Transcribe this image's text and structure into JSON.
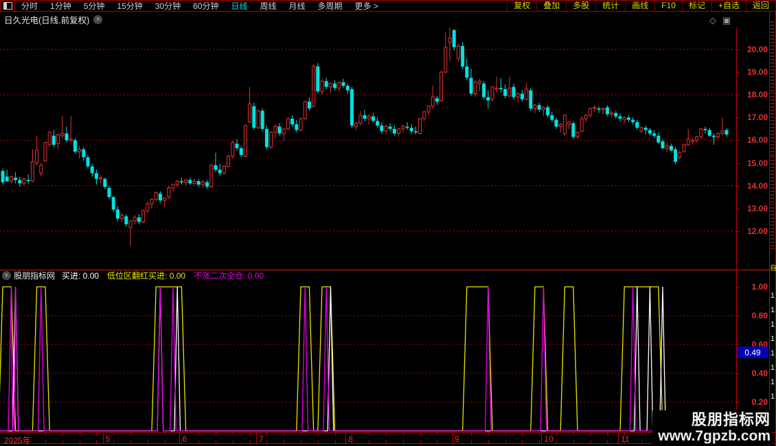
{
  "toolbar": {
    "periods": [
      "分时",
      "1分钟",
      "5分钟",
      "15分钟",
      "30分钟",
      "60分钟",
      "日线",
      "周线",
      "月线",
      "多周期"
    ],
    "active_period": "日线",
    "more_label": "更多 >",
    "right_buttons": [
      "复权",
      "叠加",
      "多股",
      "统计",
      "画线",
      "F10",
      "标记",
      "+自选",
      "返回"
    ]
  },
  "title": {
    "text": "日久光电(日线.前复权)"
  },
  "lower_header": {
    "source": "股朋指标网",
    "items": [
      {
        "label": "买进",
        "value": "0.00",
        "color": "#ffffff"
      },
      {
        "label": "低位区翻红买进",
        "value": "0.00",
        "color": "#e8e800"
      },
      {
        "label": "不涨二次全仓",
        "value": "0.00",
        "color": "#e800e8"
      }
    ]
  },
  "badge": {
    "value": "0.49"
  },
  "watermark": {
    "line1": "股朋指标网",
    "line2": "www.7gpzb.com"
  },
  "right_strip": {
    "bottom_label": "自",
    "digits": [
      "1",
      "1",
      "1",
      "1",
      "1",
      "1",
      "1",
      "1"
    ]
  },
  "colors": {
    "up": "#e63232",
    "down": "#00e2e2",
    "grid": "#b40000",
    "axis_text": "#e63232",
    "yellow": "#e8e800",
    "magenta": "#e800e8",
    "white": "#ffffff",
    "badge_bg": "#0000b4"
  },
  "chart_data": [
    {
      "type": "candlestick",
      "security": "日久光电",
      "period": "日线",
      "adjust": "前复权",
      "y_ticks": [
        "20.00",
        "19.00",
        "18.00",
        "17.00",
        "16.00",
        "15.00",
        "14.00",
        "13.00",
        "12.00"
      ],
      "y_tick_values": [
        20,
        19,
        18,
        17,
        16,
        15,
        14,
        13,
        12
      ],
      "grid_prices": [
        20,
        18,
        16,
        14,
        12
      ],
      "ylim": [
        11.3,
        21.0
      ],
      "x_ticks": [
        {
          "label": "2025年",
          "day": 0
        },
        {
          "label": "5",
          "day": 24
        },
        {
          "label": "6",
          "day": 42
        },
        {
          "label": "7",
          "day": 60
        },
        {
          "label": "8",
          "day": 81
        },
        {
          "label": "9",
          "day": 106
        },
        {
          "label": "10",
          "day": 127
        },
        {
          "label": "11",
          "day": 145
        }
      ],
      "candles": [
        [
          14.65,
          14.75,
          14.05,
          14.15
        ],
        [
          14.4,
          14.7,
          14.15,
          14.2
        ],
        [
          14.2,
          14.45,
          14.1,
          14.4
        ],
        [
          14.35,
          14.6,
          14.1,
          14.25
        ],
        [
          14.25,
          14.4,
          13.95,
          14.1
        ],
        [
          14.1,
          14.35,
          14.0,
          14.3
        ],
        [
          14.25,
          14.5,
          14.1,
          14.2
        ],
        [
          14.2,
          15.6,
          14.15,
          15.05
        ],
        [
          15.0,
          16.2,
          14.9,
          15.55
        ],
        [
          14.55,
          15.0,
          14.4,
          14.9
        ],
        [
          15.1,
          15.95,
          15.05,
          15.9
        ],
        [
          15.8,
          16.4,
          15.7,
          16.35
        ],
        [
          16.2,
          16.45,
          15.7,
          15.8
        ],
        [
          15.85,
          16.3,
          15.6,
          16.25
        ],
        [
          16.2,
          17.05,
          16.1,
          16.3
        ],
        [
          16.3,
          16.6,
          15.9,
          16.0
        ],
        [
          16.0,
          17.05,
          15.95,
          16.05
        ],
        [
          16.0,
          16.1,
          15.4,
          15.5
        ],
        [
          15.5,
          15.75,
          15.2,
          15.6
        ],
        [
          15.6,
          15.7,
          15.1,
          15.25
        ],
        [
          15.25,
          15.35,
          14.75,
          14.85
        ],
        [
          14.85,
          14.95,
          14.4,
          14.55
        ],
        [
          14.55,
          14.7,
          14.05,
          14.3
        ],
        [
          14.3,
          14.45,
          14.1,
          14.35
        ],
        [
          14.3,
          14.35,
          13.85,
          13.95
        ],
        [
          13.9,
          14.0,
          13.4,
          13.5
        ],
        [
          13.5,
          13.55,
          12.85,
          12.95
        ],
        [
          12.95,
          13.1,
          12.45,
          12.55
        ],
        [
          12.55,
          12.8,
          12.4,
          12.7
        ],
        [
          12.65,
          12.75,
          12.2,
          12.3
        ],
        [
          12.15,
          12.5,
          11.35,
          12.45
        ],
        [
          12.45,
          12.7,
          12.3,
          12.6
        ],
        [
          12.6,
          12.75,
          12.3,
          12.4
        ],
        [
          12.4,
          12.95,
          12.35,
          12.9
        ],
        [
          12.9,
          13.3,
          12.8,
          13.2
        ],
        [
          13.2,
          13.45,
          13.0,
          13.4
        ],
        [
          13.4,
          13.75,
          13.3,
          13.7
        ],
        [
          13.65,
          13.75,
          13.25,
          13.35
        ],
        [
          13.35,
          13.5,
          13.05,
          13.45
        ],
        [
          13.5,
          14.0,
          13.4,
          13.9
        ],
        [
          13.9,
          14.1,
          13.75,
          14.05
        ],
        [
          14.05,
          14.25,
          13.9,
          14.2
        ],
        [
          14.2,
          14.35,
          14.05,
          14.15
        ],
        [
          14.15,
          14.3,
          14.0,
          14.25
        ],
        [
          14.25,
          14.35,
          14.05,
          14.1
        ],
        [
          14.1,
          14.3,
          14.0,
          14.2
        ],
        [
          14.2,
          14.3,
          13.95,
          14.05
        ],
        [
          14.05,
          14.25,
          13.9,
          14.15
        ],
        [
          14.15,
          14.25,
          13.85,
          13.95
        ],
        [
          13.95,
          14.95,
          13.9,
          14.9
        ],
        [
          14.9,
          15.45,
          14.6,
          14.7
        ],
        [
          14.7,
          14.95,
          14.45,
          14.55
        ],
        [
          14.55,
          14.9,
          14.5,
          14.85
        ],
        [
          14.85,
          15.35,
          14.8,
          15.3
        ],
        [
          15.3,
          16.0,
          15.2,
          15.9
        ],
        [
          15.85,
          16.05,
          15.55,
          15.65
        ],
        [
          15.65,
          15.75,
          15.25,
          15.35
        ],
        [
          15.3,
          16.7,
          15.25,
          16.65
        ],
        [
          16.8,
          18.35,
          16.75,
          17.6
        ],
        [
          17.5,
          17.65,
          16.45,
          16.55
        ],
        [
          16.55,
          17.35,
          16.5,
          17.3
        ],
        [
          17.3,
          17.4,
          16.4,
          16.5
        ],
        [
          16.5,
          16.65,
          15.6,
          15.7
        ],
        [
          15.7,
          16.4,
          15.65,
          16.35
        ],
        [
          16.35,
          16.7,
          16.1,
          16.6
        ],
        [
          16.6,
          16.75,
          16.2,
          16.3
        ],
        [
          16.3,
          16.55,
          15.95,
          16.5
        ],
        [
          16.5,
          17.0,
          16.45,
          16.95
        ],
        [
          16.95,
          17.1,
          16.6,
          16.7
        ],
        [
          16.7,
          16.9,
          16.35,
          16.45
        ],
        [
          16.45,
          17.0,
          16.4,
          16.95
        ],
        [
          16.95,
          17.75,
          16.9,
          17.7
        ],
        [
          17.7,
          17.9,
          17.3,
          17.4
        ],
        [
          17.5,
          19.35,
          17.45,
          19.25
        ],
        [
          19.25,
          19.4,
          18.05,
          18.15
        ],
        [
          18.15,
          18.7,
          18.0,
          18.6
        ],
        [
          18.6,
          18.75,
          18.25,
          18.35
        ],
        [
          18.35,
          18.55,
          18.1,
          18.5
        ],
        [
          18.5,
          18.65,
          18.2,
          18.3
        ],
        [
          18.3,
          18.6,
          18.15,
          18.55
        ],
        [
          18.55,
          18.7,
          18.3,
          18.4
        ],
        [
          18.4,
          18.5,
          18.05,
          18.2
        ],
        [
          18.25,
          18.35,
          16.55,
          16.65
        ],
        [
          16.6,
          16.8,
          16.45,
          16.75
        ],
        [
          16.75,
          17.3,
          16.65,
          17.1
        ],
        [
          17.1,
          17.35,
          16.85,
          16.95
        ],
        [
          16.95,
          17.15,
          16.7,
          17.05
        ],
        [
          17.05,
          17.2,
          16.75,
          16.85
        ],
        [
          16.85,
          17.0,
          16.55,
          16.65
        ],
        [
          16.65,
          16.8,
          16.3,
          16.4
        ],
        [
          16.4,
          16.7,
          16.25,
          16.6
        ],
        [
          16.6,
          16.75,
          16.4,
          16.5
        ],
        [
          16.5,
          16.65,
          16.2,
          16.3
        ],
        [
          16.3,
          16.55,
          16.15,
          16.5
        ],
        [
          16.5,
          16.7,
          16.35,
          16.6
        ],
        [
          16.6,
          16.8,
          16.45,
          16.55
        ],
        [
          16.55,
          16.7,
          16.3,
          16.4
        ],
        [
          16.4,
          16.6,
          16.25,
          16.35
        ],
        [
          16.3,
          17.0,
          16.25,
          16.95
        ],
        [
          16.95,
          17.3,
          16.85,
          17.25
        ],
        [
          17.25,
          17.55,
          17.1,
          17.5
        ],
        [
          17.5,
          18.4,
          17.4,
          17.9
        ],
        [
          17.85,
          17.95,
          17.55,
          17.7
        ],
        [
          17.75,
          19.05,
          17.7,
          19.0
        ],
        [
          19.0,
          20.75,
          18.95,
          20.1
        ],
        [
          20.3,
          21.0,
          19.5,
          20.5
        ],
        [
          20.85,
          20.9,
          19.95,
          20.1
        ],
        [
          19.6,
          20.25,
          19.45,
          20.15
        ],
        [
          20.15,
          20.3,
          19.15,
          19.25
        ],
        [
          19.25,
          19.6,
          18.65,
          18.75
        ],
        [
          18.75,
          19.15,
          17.95,
          18.05
        ],
        [
          18.05,
          18.65,
          17.9,
          18.55
        ],
        [
          18.5,
          18.7,
          18.15,
          18.6
        ],
        [
          18.5,
          18.6,
          17.8,
          17.9
        ],
        [
          17.9,
          18.2,
          17.4,
          17.75
        ],
        [
          17.8,
          18.4,
          17.7,
          18.35
        ],
        [
          18.25,
          18.8,
          18.1,
          18.3
        ],
        [
          18.3,
          18.75,
          18.1,
          18.25
        ],
        [
          18.25,
          18.45,
          17.85,
          17.95
        ],
        [
          17.95,
          18.8,
          17.9,
          18.3
        ],
        [
          18.35,
          18.5,
          17.8,
          17.9
        ],
        [
          17.9,
          18.1,
          17.65,
          18.05
        ],
        [
          18.05,
          18.2,
          17.7,
          17.8
        ],
        [
          17.8,
          18.55,
          17.75,
          18.25
        ],
        [
          18.2,
          18.3,
          17.3,
          17.4
        ],
        [
          17.4,
          17.6,
          17.2,
          17.55
        ],
        [
          17.55,
          17.65,
          17.25,
          17.35
        ],
        [
          17.35,
          17.5,
          17.05,
          17.45
        ],
        [
          17.45,
          17.55,
          17.0,
          17.1
        ],
        [
          17.1,
          17.25,
          16.8,
          16.9
        ],
        [
          16.9,
          17.0,
          16.5,
          16.6
        ],
        [
          16.6,
          16.75,
          16.35,
          16.7
        ],
        [
          16.3,
          17.15,
          16.2,
          17.1
        ],
        [
          16.7,
          16.85,
          16.5,
          16.8
        ],
        [
          16.75,
          16.85,
          16.05,
          16.15
        ],
        [
          16.15,
          16.4,
          16.05,
          16.35
        ],
        [
          16.4,
          17.05,
          16.35,
          16.95
        ],
        [
          16.95,
          17.15,
          16.8,
          17.1
        ],
        [
          17.1,
          17.45,
          17.0,
          17.4
        ],
        [
          17.4,
          17.55,
          17.25,
          17.45
        ],
        [
          17.4,
          17.5,
          17.2,
          17.35
        ],
        [
          17.35,
          17.45,
          17.15,
          17.4
        ],
        [
          17.45,
          17.55,
          17.05,
          17.15
        ],
        [
          17.15,
          17.3,
          17.0,
          17.2
        ],
        [
          17.2,
          17.3,
          16.95,
          17.05
        ],
        [
          17.05,
          17.2,
          16.85,
          16.95
        ],
        [
          16.9,
          17.05,
          16.75,
          17.0
        ],
        [
          17.0,
          17.1,
          16.8,
          16.9
        ],
        [
          16.9,
          17.0,
          16.7,
          16.8
        ],
        [
          16.8,
          16.9,
          16.45,
          16.55
        ],
        [
          16.4,
          16.6,
          16.3,
          16.55
        ],
        [
          16.55,
          16.65,
          16.25,
          16.45
        ],
        [
          16.45,
          16.55,
          16.2,
          16.3
        ],
        [
          16.3,
          16.45,
          16.1,
          16.2
        ],
        [
          16.2,
          16.35,
          15.85,
          15.9
        ],
        [
          15.95,
          16.05,
          15.6,
          15.65
        ],
        [
          15.65,
          15.9,
          15.5,
          15.75
        ],
        [
          15.75,
          15.85,
          15.5,
          15.55
        ],
        [
          15.6,
          15.7,
          14.95,
          15.05
        ],
        [
          15.25,
          15.55,
          15.15,
          15.45
        ],
        [
          15.5,
          15.85,
          15.45,
          15.8
        ],
        [
          15.8,
          16.5,
          15.75,
          16.05
        ],
        [
          15.95,
          16.1,
          15.8,
          16.0
        ],
        [
          16.0,
          16.2,
          15.9,
          16.15
        ],
        [
          16.15,
          16.55,
          16.05,
          16.5
        ],
        [
          16.5,
          16.6,
          16.3,
          16.45
        ],
        [
          16.45,
          16.55,
          16.15,
          16.2
        ],
        [
          16.2,
          16.3,
          15.8,
          16.15
        ],
        [
          16.15,
          16.35,
          16.05,
          16.3
        ],
        [
          16.3,
          17.0,
          16.2,
          16.4
        ],
        [
          16.45,
          16.55,
          16.15,
          16.25
        ]
      ]
    },
    {
      "type": "line",
      "title": "股朋指标网",
      "ylim": [
        0,
        1.05
      ],
      "y_ticks": [
        {
          "label": "1.00",
          "v": 1.0
        },
        {
          "label": "0.80",
          "v": 0.8
        },
        {
          "label": "0.60",
          "v": 0.6
        },
        {
          "label": "0.40",
          "v": 0.4
        },
        {
          "label": "0.20",
          "v": 0.2
        }
      ],
      "grid_values": [
        0.8,
        0.6,
        0.4,
        0.2
      ],
      "latest_marker": {
        "label": "0.49",
        "v": 0.49
      },
      "legend_position": "top-left",
      "series": [
        {
          "name": "低位区翻红买进",
          "color": "#e8e800",
          "pulses": [
            [
              0,
              2
            ],
            [
              8,
              10
            ],
            [
              36,
              42
            ],
            [
              70,
              72
            ],
            [
              75,
              77
            ],
            [
              109,
              114
            ],
            [
              125,
              127
            ],
            [
              132,
              134
            ],
            [
              146,
              154
            ]
          ]
        },
        {
          "name": "买进",
          "color": "#ffffff",
          "spikes": [
            3,
            37,
            41,
            77,
            149,
            152,
            155
          ]
        },
        {
          "name": "不涨二次全仓",
          "color": "#e800e8",
          "spikes": [
            2,
            3,
            9,
            37,
            40,
            71,
            76,
            114,
            127,
            148
          ]
        }
      ]
    }
  ]
}
